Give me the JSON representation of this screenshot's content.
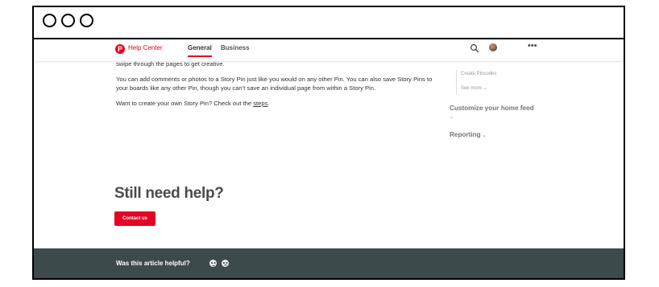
{
  "window": {
    "controls": [
      "close",
      "minimize",
      "maximize"
    ]
  },
  "nav": {
    "logo_letter": "P",
    "brand_label": "Help Center",
    "tabs": [
      {
        "label": "General",
        "active": true
      },
      {
        "label": "Business",
        "active": false
      }
    ],
    "search_icon": "search-icon",
    "avatar": "user-avatar",
    "more_label": "•••",
    "accent_color": "#e60023"
  },
  "article": {
    "partial_line": "swipe through the pages to get creative.",
    "paragraph2": "You can add comments or photos to a Story Pin just like you would on any other Pin. You can also save Story Pins to your boards like any other Pin, though you can’t save an individual page from within a Story Pin.",
    "paragraph3_prefix": "Want to create your own Story Pin? Check out the ",
    "paragraph3_link": "steps",
    "paragraph3_suffix": "."
  },
  "sidebar": {
    "sub_item": "Create Pincodes",
    "see_more": "See more",
    "see_more_chevron": "⌄",
    "sections": [
      {
        "label": "Customize your home feed",
        "chevron": "⌄"
      },
      {
        "label": "Reporting",
        "chevron": "⌄"
      }
    ]
  },
  "help": {
    "heading": "Still need help?",
    "button_label": "Contact us"
  },
  "footer": {
    "question": "Was this article helpful?",
    "background": "#3d4a4b",
    "reactions": [
      "happy-face-icon",
      "sad-face-icon"
    ]
  }
}
